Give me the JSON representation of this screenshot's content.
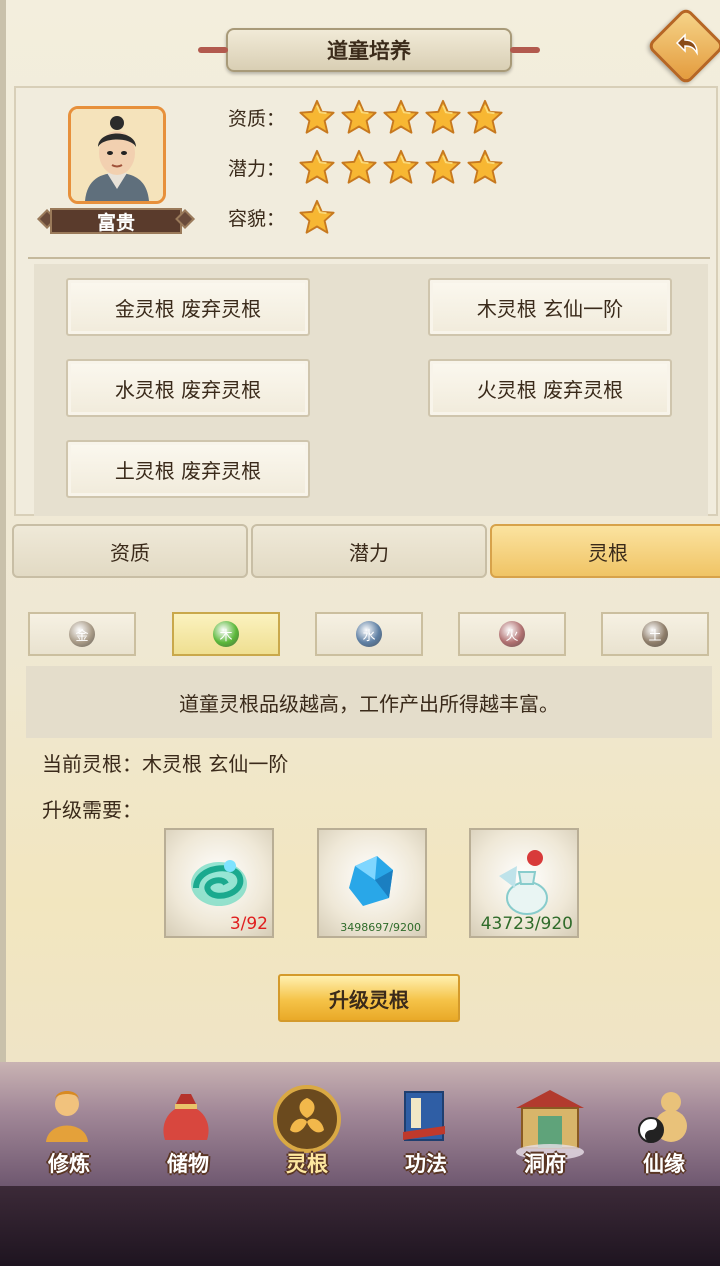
{
  "header": {
    "title": "道童培养"
  },
  "character": {
    "name": "富贵",
    "attributes": [
      {
        "label": "资质：",
        "stars": 5
      },
      {
        "label": "潜力：",
        "stars": 5
      },
      {
        "label": "容貌：",
        "stars": 1
      }
    ]
  },
  "spirit_roots": [
    "金灵根 废弃灵根",
    "木灵根 玄仙一阶",
    "水灵根 废弃灵根",
    "火灵根 废弃灵根",
    "土灵根 废弃灵根"
  ],
  "tabs": [
    {
      "label": "资质",
      "active": false
    },
    {
      "label": "潜力",
      "active": false
    },
    {
      "label": "灵根",
      "active": true
    }
  ],
  "elements": [
    {
      "label": "金",
      "color": "#a89a86",
      "active": false
    },
    {
      "label": "木",
      "color": "#5cb83a",
      "active": true
    },
    {
      "label": "水",
      "color": "#5e7fa3",
      "active": false
    },
    {
      "label": "火",
      "color": "#b07070",
      "active": false
    },
    {
      "label": "土",
      "color": "#8f7e6a",
      "active": false
    }
  ],
  "info": {
    "hint": "道童灵根品级越高，工作产出所得越丰富。",
    "current": "当前灵根：木灵根 玄仙一阶",
    "need": "升级需要："
  },
  "materials": [
    {
      "icon": "spirit-swirl-icon",
      "count": "3/92",
      "count_color": "#e01e1e"
    },
    {
      "icon": "blue-crystal-icon",
      "count": "3498697/9200",
      "count_color": "#2f6b2a"
    },
    {
      "icon": "elixir-vase-icon",
      "count": "43723/920",
      "count_color": "#2f6b2a"
    }
  ],
  "upgrade_label": "升级灵根",
  "nav": [
    {
      "label": "修炼",
      "icon": "meditating-monk-icon",
      "active": false
    },
    {
      "label": "储物",
      "icon": "storage-bag-icon",
      "active": false
    },
    {
      "label": "灵根",
      "icon": "spirit-root-emblem-icon",
      "active": true
    },
    {
      "label": "功法",
      "icon": "scripture-book-icon",
      "active": false
    },
    {
      "label": "洞府",
      "icon": "cave-palace-icon",
      "active": false
    },
    {
      "label": "仙缘",
      "icon": "gourd-taiji-icon",
      "active": false
    }
  ]
}
